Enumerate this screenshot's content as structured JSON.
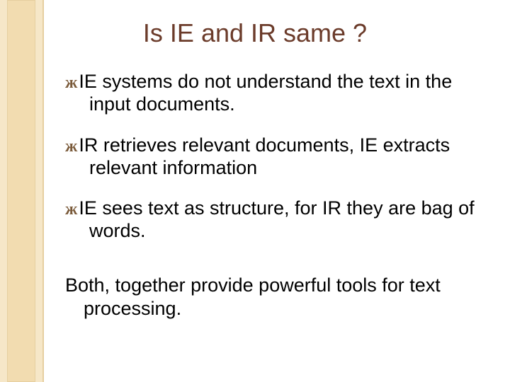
{
  "slide": {
    "title": "Is IE and IR same ?",
    "bullet_glyph": "ж",
    "bullets": [
      "IE systems do not understand the text in the input documents.",
      "IR retrieves relevant documents, IE extracts relevant information",
      "IE sees text as structure, for IR they are bag of words."
    ],
    "closing": "Both, together provide powerful tools for text processing."
  }
}
